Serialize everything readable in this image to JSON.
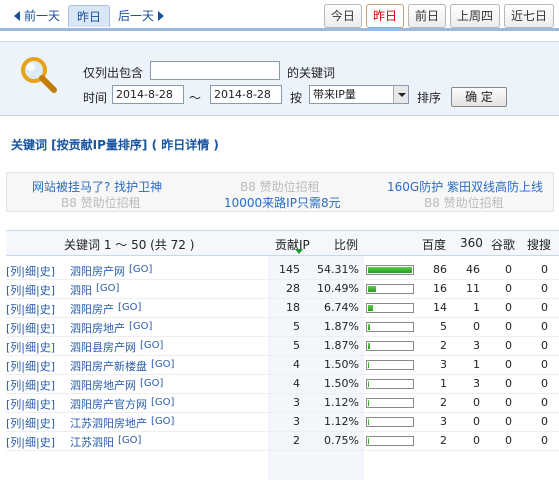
{
  "nav": {
    "prev_day": "前一天",
    "yesterday": "昨日",
    "next_day": "后一天",
    "right": [
      "今日",
      "昨日",
      "前日",
      "上周四",
      "近七日"
    ],
    "right_active_index": 1
  },
  "search": {
    "only_list_label": "仅列出包含",
    "keyword_value": "",
    "keyword_suffix": "的关键词",
    "time_label": "时间",
    "date_from": "2014-8-28",
    "tilde": "～",
    "date_to": "2014-8-28",
    "by_label": "按",
    "sort_select": "带来IP量",
    "sort_label": "排序",
    "ok_button": "确 定"
  },
  "section_title": "关键词 [按贡献IP量排序] ( 昨日详情 )",
  "ads": {
    "a1": "网站被挂马了? 找护卫神",
    "a2": "B8 赞助位招租",
    "a3": "160G防护 紫田双线高防上线",
    "a4": "B8 赞助位招租",
    "a5": "10000来路IP只需8元",
    "a6": "B8 赞助位招租"
  },
  "table": {
    "headers": {
      "keyword": "关键词 1 ～ 50 (共 72 )",
      "ip": "贡献IP",
      "ratio": "比例",
      "baidu": "百度",
      "s360": "360",
      "google": "谷歌",
      "sogou": "搜搜"
    },
    "row_links": "[列|细|史]",
    "go_label": "[GO]",
    "rows": [
      {
        "kw": "泗阳房产网",
        "ip": "145",
        "pct": "54.31%",
        "ratio": 0.5431,
        "bd": "86",
        "s360": "46",
        "gg": "0",
        "sg": "0"
      },
      {
        "kw": "泗阳",
        "ip": "28",
        "pct": "10.49%",
        "ratio": 0.1049,
        "bd": "16",
        "s360": "11",
        "gg": "0",
        "sg": "0"
      },
      {
        "kw": "泗阳房产",
        "ip": "18",
        "pct": "6.74%",
        "ratio": 0.0674,
        "bd": "14",
        "s360": "1",
        "gg": "0",
        "sg": "0"
      },
      {
        "kw": "泗阳房地产",
        "ip": "5",
        "pct": "1.87%",
        "ratio": 0.0187,
        "bd": "5",
        "s360": "0",
        "gg": "0",
        "sg": "0"
      },
      {
        "kw": "泗阳县房产网",
        "ip": "5",
        "pct": "1.87%",
        "ratio": 0.0187,
        "bd": "2",
        "s360": "3",
        "gg": "0",
        "sg": "0"
      },
      {
        "kw": "泗阳房产新楼盘",
        "ip": "4",
        "pct": "1.50%",
        "ratio": 0.015,
        "bd": "3",
        "s360": "1",
        "gg": "0",
        "sg": "0"
      },
      {
        "kw": "泗阳房地产网",
        "ip": "4",
        "pct": "1.50%",
        "ratio": 0.015,
        "bd": "1",
        "s360": "3",
        "gg": "0",
        "sg": "0"
      },
      {
        "kw": "泗阳房产官方网",
        "ip": "3",
        "pct": "1.12%",
        "ratio": 0.0112,
        "bd": "2",
        "s360": "0",
        "gg": "0",
        "sg": "0"
      },
      {
        "kw": "江苏泗阳房地产",
        "ip": "3",
        "pct": "1.12%",
        "ratio": 0.0112,
        "bd": "3",
        "s360": "0",
        "gg": "0",
        "sg": "0"
      },
      {
        "kw": "江苏泗阳",
        "ip": "2",
        "pct": "0.75%",
        "ratio": 0.0075,
        "bd": "2",
        "s360": "0",
        "gg": "0",
        "sg": "0"
      }
    ]
  },
  "colors": {
    "link": "#2a5ca8",
    "title": "#1a55a0",
    "bar_fill": "#2a9a20",
    "active_red": "#cc0000"
  }
}
